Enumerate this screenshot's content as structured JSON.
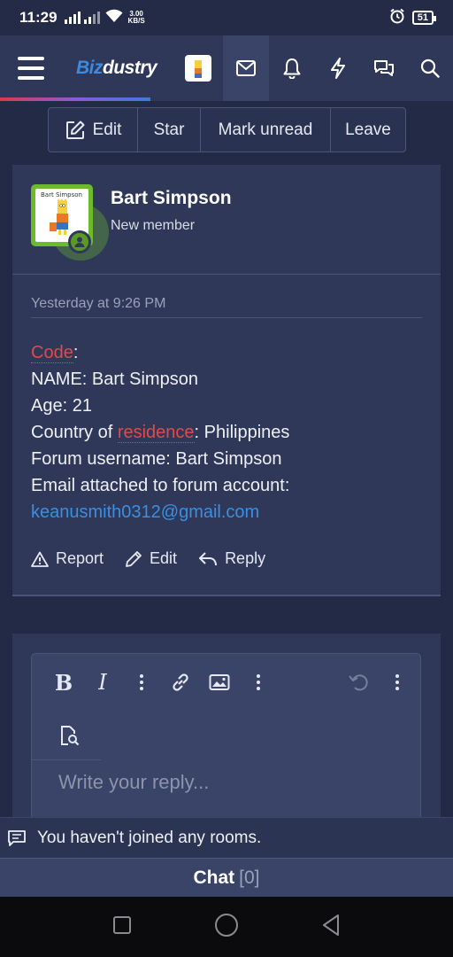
{
  "status_bar": {
    "time": "11:29",
    "net_speed_value": "3.00",
    "net_speed_unit": "KB/S",
    "battery": "51"
  },
  "nav": {
    "logo_part1": "Biz",
    "logo_part2": "dustry",
    "icons": [
      "avatar",
      "inbox-icon",
      "bell-icon",
      "bolt-icon",
      "chat-bubbles-icon",
      "search-icon"
    ]
  },
  "actions": {
    "edit": "Edit",
    "star": "Star",
    "mark_unread": "Mark unread",
    "leave": "Leave"
  },
  "post": {
    "avatar_caption": "Bart Simpson",
    "username": "Bart Simpson",
    "user_title": "New member",
    "date": "Yesterday at 9:26 PM",
    "body": {
      "code_word": "Code",
      "code_suffix": ":",
      "name_line": "NAME: Bart Simpson",
      "age_line": "Age: 21",
      "country_prefix": "Country of ",
      "country_keyword": "residence",
      "country_suffix": ": Philippines",
      "forum_user_line": "Forum username: Bart Simpson",
      "email_label": "Email attached to forum account:",
      "email_link": "keanusmith0312@gmail.com"
    },
    "footer": {
      "report": "Report",
      "edit": "Edit",
      "reply": "Reply"
    }
  },
  "editor": {
    "bold": "B",
    "italic": "I",
    "placeholder": "Write your reply..."
  },
  "chat": {
    "notice": "You haven't joined any rooms.",
    "label": "Chat",
    "count": "[0]"
  },
  "colors": {
    "background": "#232a45",
    "card": "#2f3859",
    "accent_red": "#e04a4a",
    "link_blue": "#3b8fe0",
    "online_green": "#6dbb2a"
  }
}
